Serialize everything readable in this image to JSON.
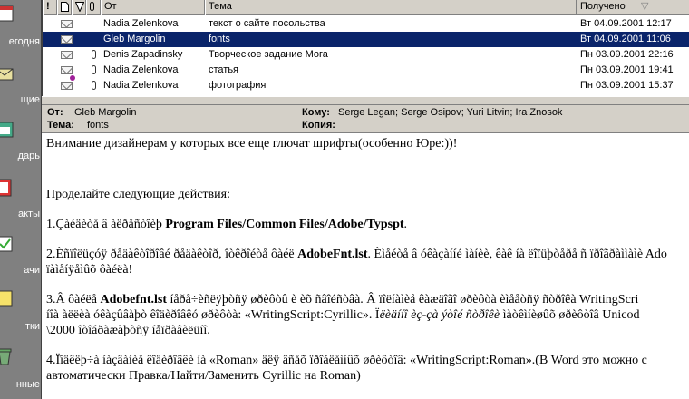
{
  "sidebar": {
    "items": [
      {
        "label": "Сегодня",
        "icon": "today-icon"
      },
      {
        "label": "Входящие",
        "icon": "inbox-icon",
        "label_visible": "щие"
      },
      {
        "label": "Календарь",
        "icon": "calendar-icon",
        "label_visible": "дарь"
      },
      {
        "label": "Контакты",
        "icon": "contacts-icon",
        "label_visible": "акты"
      },
      {
        "label": "Задачи",
        "icon": "tasks-icon",
        "label_visible": "ачи"
      },
      {
        "label": "Заметки",
        "icon": "notes-icon",
        "label_visible": "тки"
      },
      {
        "label": "Удаленные",
        "icon": "deleted-items-icon",
        "label_visible": "нные"
      }
    ],
    "visible_labels": [
      "егодня",
      "щие",
      "дарь",
      "акты",
      "ачи",
      "тки",
      "нные"
    ]
  },
  "list": {
    "columns": {
      "from": "От",
      "subject": "Тема",
      "received": "Получено"
    },
    "rows": [
      {
        "from": "Nadia Zelenkova",
        "subject": "текст о сайте посольства",
        "received": "Вт 04.09.2001 12:17",
        "attachment": false,
        "selected": false
      },
      {
        "from": "Gleb Margolin",
        "subject": "fonts",
        "received": "Вт 04.09.2001 11:06",
        "attachment": false,
        "selected": true
      },
      {
        "from": "Denis Zapadinsky",
        "subject": "Творческое задание Мога",
        "received": "Пн 03.09.2001 22:16",
        "attachment": true,
        "selected": false
      },
      {
        "from": "Nadia Zelenkova",
        "subject": "статья",
        "received": "Пн 03.09.2001 19:41",
        "attachment": true,
        "selected": false
      },
      {
        "from": "Nadia Zelenkova",
        "subject": "фотография",
        "received": "Пн 03.09.2001 15:37",
        "attachment": true,
        "selected": false
      }
    ]
  },
  "preview": {
    "from_label": "От:",
    "from_value": "Gleb Margolin",
    "subject_label": "Тема:",
    "subject_value": "fonts",
    "to_label": "Кому:",
    "to_value": "Serge Legan; Serge Osipov; Yuri Litvin; Ira Znosok",
    "cc_label": "Копия:",
    "cc_value": ""
  },
  "body": {
    "p1": "Внимание дизайнерам у которых все еще глючат шрифты(особенно Юре:))!",
    "p2": "Проделайте следующие действия:",
    "p3_a": "1.Çàéäèòå â àëðåñòîèþ ",
    "p3_b": "Program Files/Common Files/Adobe/Typspt",
    "p3_c": ".",
    "p4_a": "2.Èñïîëüçóÿ ðåäàêòîðîâé ðåäàêòîð, îòêðîéòå ôàéë ",
    "p4_b": "AdobeFnt.lst",
    "p4_c": ". Èìåéòå â óêàçàííé ìàíèè, êàê íà ëîïüþòåðå ñ ïðîãðàììàìè Ado",
    "p4_d": "ïàìåíÿåìûõ ôàéëà!",
    "p5_a": "3.Â ôàéëå ",
    "p5_b": "Adobefnt.lst",
    "p5_c": " íåðå÷èñëÿþòñÿ øðèôòû è èõ ñâîéñòâà. Â ïîëíàìèå êàæäîãî øðèôòà èìååòñÿ ñòðîêà WritingScri",
    "p5_d": "íîà àëëèà óêàçûâàþò êîäèðîâêó øðèôòà: «WritingScript:Cyrillic». Ï",
    "p5_e": "ëèäííî èç-çà ýòîé ñòðîêè",
    "p5_f": " ìàòêìíèøûõ øðèôòîâ Unicod",
    "p5_g": "\\2000 îòîáðàæàþòñÿ íåïðàâèëüíî.",
    "p6_a": "4.Ïîäêëþ÷à íàçâàíèå êîäèðîâêè íà «Roman» äëÿ âñåõ ïðîáëåìíûõ øðèôòîâ: «WritingScript:Roman».",
    "p6_b": "(В Word это можно с",
    "p6_c": "автоматически Правка/Найти/Заменить Cyrillic на Roman)"
  },
  "colors": {
    "selection": "#0a246a",
    "chrome": "#d4d0c8",
    "outlook_bar": "#808080"
  }
}
